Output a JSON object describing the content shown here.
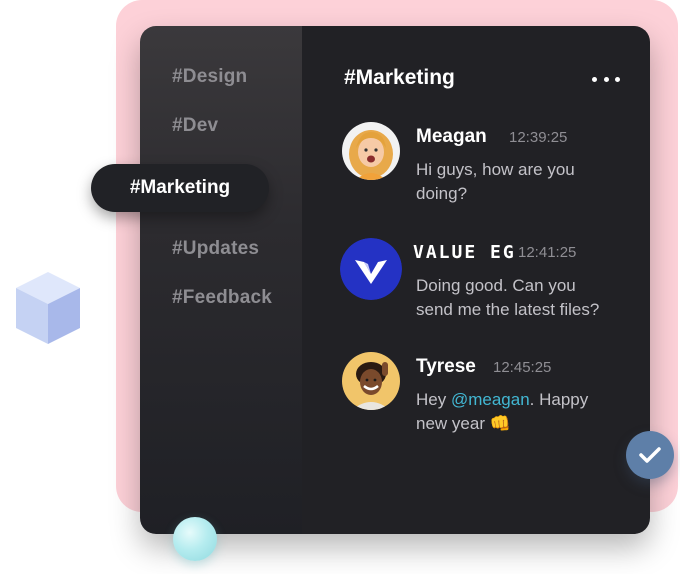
{
  "sidebar": {
    "channels": [
      {
        "label": "#Design"
      },
      {
        "label": "#Dev"
      },
      {
        "label": "#Marketing",
        "active": true
      },
      {
        "label": "#Updates"
      },
      {
        "label": "#Feedback"
      }
    ]
  },
  "chat": {
    "title": "#Marketing",
    "more_icon": "more-horizontal-icon",
    "messages": [
      {
        "name": "Meagan",
        "time": "12:39:25",
        "text": "Hi guys, how are you doing?"
      },
      {
        "name": "VALUE EG",
        "time": "12:41:25",
        "text": "Doing good. Can you send me the latest files?"
      },
      {
        "name": "Tyrese",
        "time": "12:45:25",
        "text_before": "Hey ",
        "mention": "@meagan",
        "text_after": ". Happy new year 👊"
      }
    ]
  },
  "decor": {
    "check_icon": "checkmark-icon"
  },
  "colors": {
    "accent": "#42b7d3",
    "pink": "#fdd1d8",
    "window": "#212125",
    "check": "#5e7fa8"
  }
}
